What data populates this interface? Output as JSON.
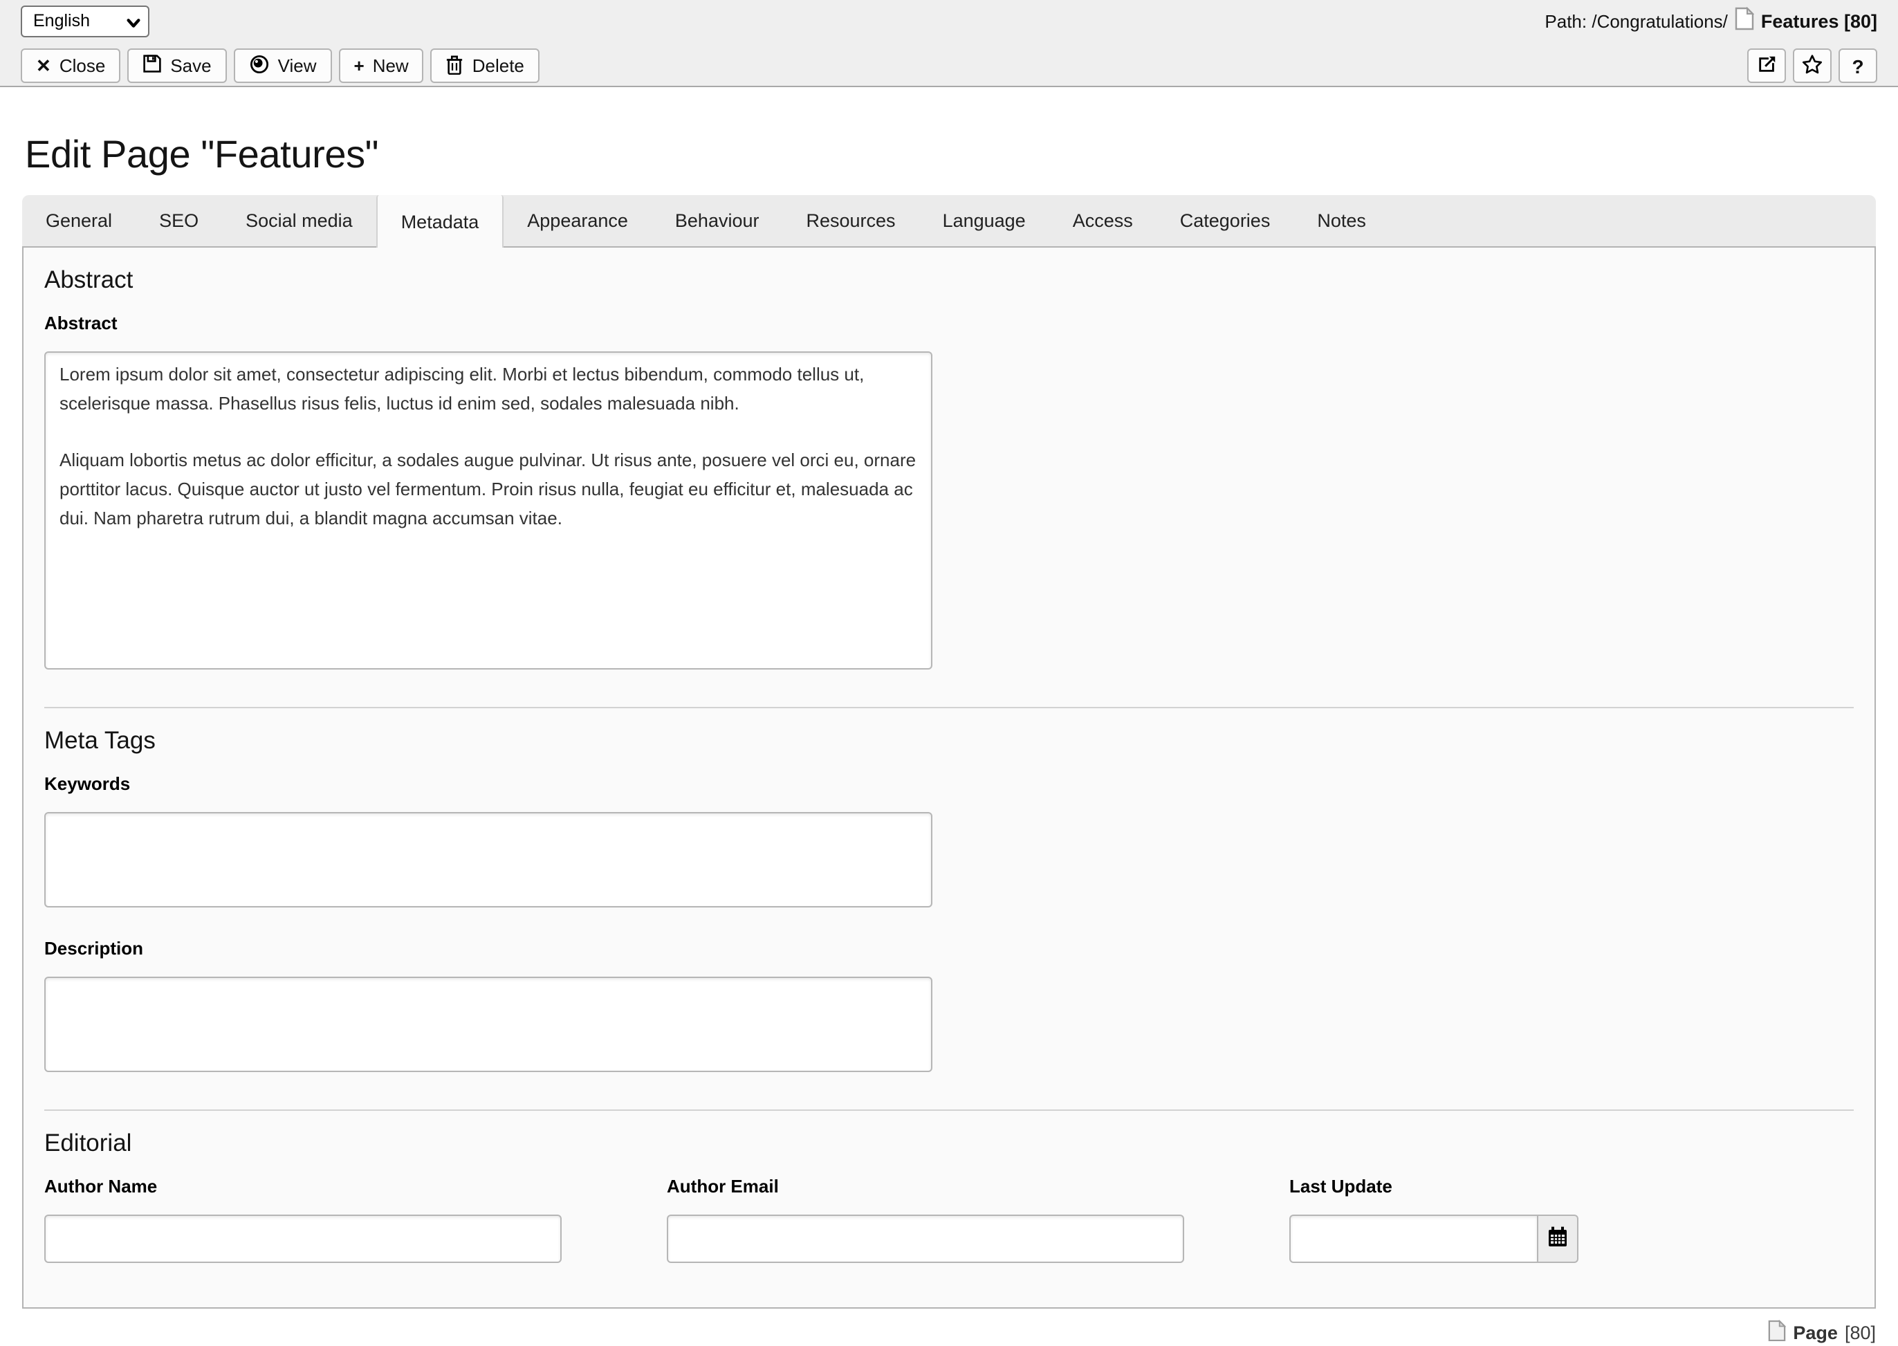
{
  "docheader": {
    "language_select": {
      "value": "English"
    },
    "path_label": "Path: /Congratulations/",
    "record_title": "Features [80]",
    "buttons": {
      "close": "Close",
      "save": "Save",
      "view": "View",
      "new": "New",
      "delete": "Delete"
    },
    "icon_buttons": {
      "open_in_new_window": "open-in-new-window",
      "bookmark": "bookmark-star",
      "help": "?"
    },
    "icons": {
      "close_glyph": "✕",
      "new_glyph": "+",
      "help_glyph": "?"
    }
  },
  "page": {
    "title": "Edit Page \"Features\""
  },
  "tabs": [
    "General",
    "SEO",
    "Social media",
    "Metadata",
    "Appearance",
    "Behaviour",
    "Resources",
    "Language",
    "Access",
    "Categories",
    "Notes"
  ],
  "active_tab": "Metadata",
  "sections": {
    "abstract": {
      "heading": "Abstract",
      "abstract_label": "Abstract",
      "abstract_value": "Lorem ipsum dolor sit amet, consectetur adipiscing elit. Morbi et lectus bibendum, commodo tellus ut, scelerisque massa. Phasellus risus felis, luctus id enim sed, sodales malesuada nibh.\n\nAliquam lobortis metus ac dolor efficitur, a sodales augue pulvinar. Ut risus ante, posuere vel orci eu, ornare porttitor lacus. Quisque auctor ut justo vel fermentum. Proin risus nulla, feugiat eu efficitur et, malesuada ac dui. Nam pharetra rutrum dui, a blandit magna accumsan vitae."
    },
    "meta_tags": {
      "heading": "Meta Tags",
      "keywords_label": "Keywords",
      "keywords_value": "",
      "description_label": "Description",
      "description_value": ""
    },
    "editorial": {
      "heading": "Editorial",
      "author_name_label": "Author Name",
      "author_name_value": "",
      "author_email_label": "Author Email",
      "author_email_value": "",
      "last_update_label": "Last Update",
      "last_update_value": ""
    }
  },
  "footer": {
    "record_type": "Page",
    "record_id": "[80]"
  },
  "colors": {
    "docheader_bg": "#efefef",
    "panel_bg": "#fafafa",
    "panel_border": "#b3b3b3",
    "tabstrip_bg": "#ebebeb",
    "button_border": "#b4b4b4"
  }
}
